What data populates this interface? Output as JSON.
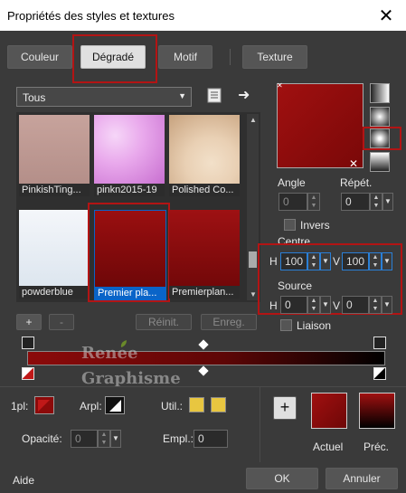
{
  "window": {
    "title": "Propriétés des styles et textures",
    "close": "✕"
  },
  "tabs": [
    {
      "label": "Couleur"
    },
    {
      "label": "Dégradé"
    },
    {
      "label": "Motif"
    },
    {
      "label": "Texture"
    }
  ],
  "gradient_filter": {
    "value": "Tous"
  },
  "thumbnails": [
    {
      "caption": "PinkishTing...",
      "colors": [
        "#c7a39c",
        "#b48f89"
      ]
    },
    {
      "caption": "pinkn2015-19",
      "colors": [
        "#e9a9ec",
        "#c86fd0"
      ]
    },
    {
      "caption": "Polished Co...",
      "colors": [
        "#e9d0b4",
        "#c7a27e"
      ]
    },
    {
      "caption": "powderblue",
      "colors": [
        "#f4f6fa",
        "#dde6ef"
      ]
    },
    {
      "caption": "Premier pla...",
      "colors": [
        "#9a0f10",
        "#6e0708"
      ]
    },
    {
      "caption": "Premierplan...",
      "colors": [
        "#9e1113",
        "#730809"
      ]
    }
  ],
  "list_buttons": {
    "add": "+",
    "remove": "-",
    "reset": "Réinit.",
    "save": "Enreg."
  },
  "angle": {
    "label": "Angle",
    "value": "0"
  },
  "repeat": {
    "label": "Répét.",
    "value": "0"
  },
  "invert": {
    "label": "Invers",
    "checked": false
  },
  "centre": {
    "label": "Centre",
    "h_label": "H",
    "h_value": "100",
    "v_label": "V",
    "v_value": "100"
  },
  "source": {
    "label": "Source",
    "h_label": "H",
    "h_value": "0",
    "v_label": "V",
    "v_value": "0"
  },
  "link": {
    "label": "Liaison",
    "checked": false
  },
  "gradient_colors": {
    "start": "#8c0a0a",
    "end": "#000000"
  },
  "watermark": {
    "line1": "Renee",
    "line2": "Graphisme"
  },
  "stop_settings": {
    "first_label": "1pl:",
    "arpl_label": "Arpl:",
    "util_label": "Util.:",
    "util_color": "#e8c640",
    "opacity_label": "Opacité:",
    "opacity_value": "0",
    "empl_label": "Empl.:",
    "empl_value": "0"
  },
  "preview": {
    "add": "+",
    "current_label": "Actuel",
    "previous_label": "Préc."
  },
  "footer": {
    "help": "Aide",
    "ok": "OK",
    "cancel": "Annuler"
  }
}
